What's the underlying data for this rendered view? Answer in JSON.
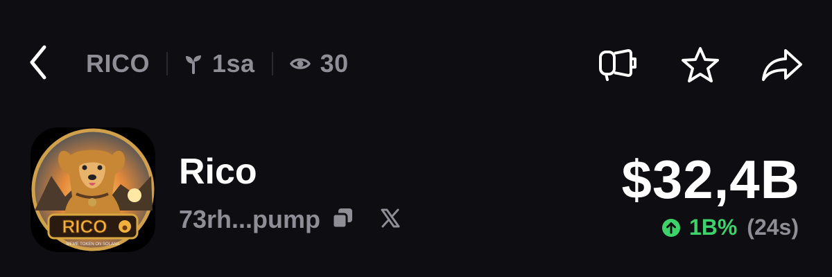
{
  "header": {
    "ticker": "RICO",
    "age": "1sa",
    "views": "30"
  },
  "token": {
    "name": "Rico",
    "address": "73rh...pump",
    "logo_text": "RICO",
    "logo_tagline": "MEME TOKEN ON SOLANA",
    "price": "$32,4B",
    "change": "1B%",
    "period": "(24s)"
  },
  "icons": {
    "back": "chevron-left-icon",
    "age": "sprout-icon",
    "views": "eye-icon",
    "announce": "megaphone-icon",
    "favorite": "star-icon",
    "share": "share-arrow-icon",
    "copy": "copy-icon",
    "x": "x-logo-icon",
    "change": "arrow-up-circle-icon"
  },
  "colors": {
    "background": "#0e0d12",
    "muted": "#8f8e96",
    "positive": "#3dd26a"
  }
}
